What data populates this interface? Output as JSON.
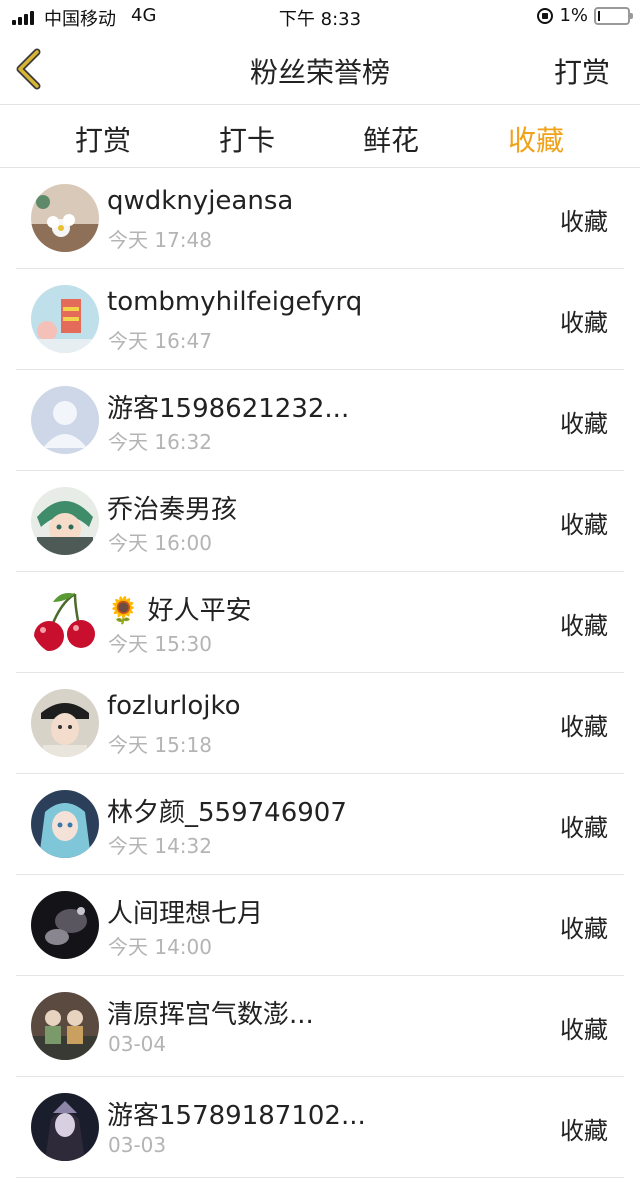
{
  "status_bar": {
    "carrier": "中国移动",
    "network": "4G",
    "time": "下午 8:33",
    "battery": "1%"
  },
  "nav": {
    "title": "粉丝荣誉榜",
    "right_action": "打赏",
    "back_icon": "chevron-left-icon",
    "back_color": "#c9a227"
  },
  "tabs": [
    {
      "label": "打赏"
    },
    {
      "label": "打卡"
    },
    {
      "label": "鲜花"
    },
    {
      "label": "收藏"
    }
  ],
  "active_tab": "收藏",
  "accent_color": "#f0a21a",
  "fans": [
    {
      "name": "qwdknyjeansa",
      "time": "今天 17:48",
      "action": "收藏"
    },
    {
      "name": "tombmyhilfeigefyrq",
      "time": "今天 16:47",
      "action": "收藏"
    },
    {
      "name": "游客1598621232...",
      "time": "今天 16:32",
      "action": "收藏"
    },
    {
      "name": "乔治奏男孩",
      "time": "今天 16:00",
      "action": "收藏"
    },
    {
      "name": "🌻 好人平安",
      "time": "今天 15:30",
      "action": "收藏"
    },
    {
      "name": "fozlurlojko",
      "time": "今天 15:18",
      "action": "收藏"
    },
    {
      "name": "林夕颜_559746907",
      "time": "今天 14:32",
      "action": "收藏"
    },
    {
      "name": "人间理想七月",
      "time": "今天 14:00",
      "action": "收藏"
    },
    {
      "name": "清原挥宫气数澎...",
      "time": "03-04",
      "action": "收藏"
    },
    {
      "name": "游客15789187102...",
      "time": "03-03",
      "action": "收藏"
    }
  ]
}
